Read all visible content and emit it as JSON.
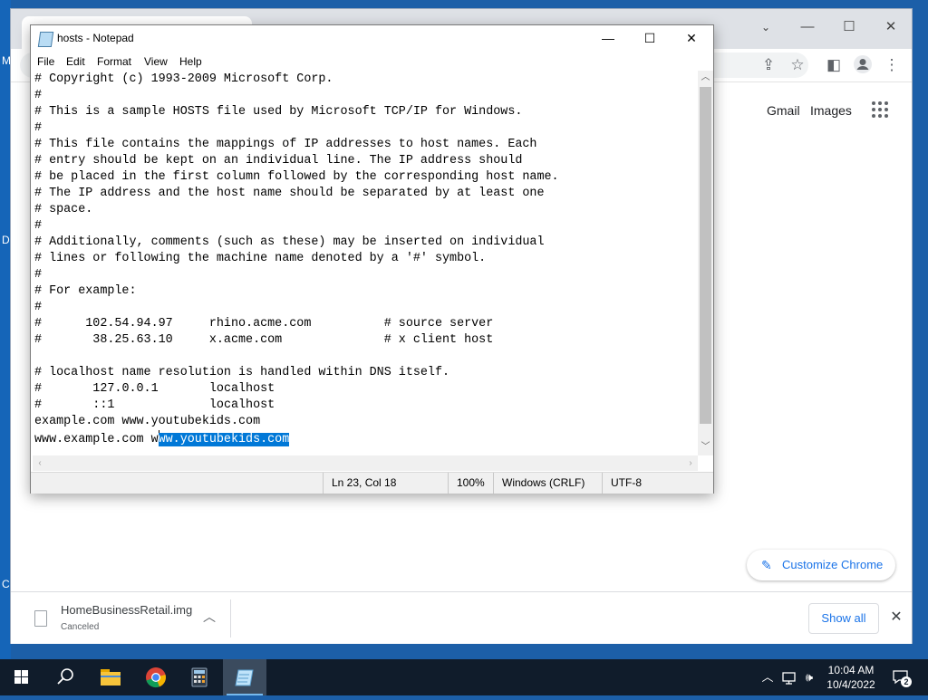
{
  "desktop": {
    "side_letters": [
      "M",
      "D",
      "C"
    ]
  },
  "chrome": {
    "header_links": {
      "gmail": "Gmail",
      "images": "Images"
    },
    "customize_label": "Customize Chrome",
    "download": {
      "filename": "HomeBusinessRetail.img",
      "status": "Canceled"
    },
    "show_all_label": "Show all",
    "icons": [
      "share-icon",
      "bookmark-star-icon",
      "side-panel-icon",
      "profile-icon",
      "kebab-menu-icon",
      "apps-grid-icon"
    ]
  },
  "notepad": {
    "title": "hosts - Notepad",
    "menu": [
      "File",
      "Edit",
      "Format",
      "View",
      "Help"
    ],
    "lines": [
      "# Copyright (c) 1993-2009 Microsoft Corp.",
      "#",
      "# This is a sample HOSTS file used by Microsoft TCP/IP for Windows.",
      "#",
      "# This file contains the mappings of IP addresses to host names. Each",
      "# entry should be kept on an individual line. The IP address should",
      "# be placed in the first column followed by the corresponding host name.",
      "# The IP address and the host name should be separated by at least one",
      "# space.",
      "#",
      "# Additionally, comments (such as these) may be inserted on individual",
      "# lines or following the machine name denoted by a '#' symbol.",
      "#",
      "# For example:",
      "#",
      "#      102.54.94.97     rhino.acme.com          # source server",
      "#       38.25.63.10     x.acme.com              # x client host",
      "",
      "# localhost name resolution is handled within DNS itself.",
      "#\t127.0.0.1       localhost",
      "#\t::1             localhost",
      "example.com www.youtubekids.com"
    ],
    "last_line": {
      "before": "www.example.com w",
      "selected": "ww.youtubekids.com"
    },
    "status": {
      "position": "Ln 23, Col 18",
      "zoom": "100%",
      "line_ending": "Windows (CRLF)",
      "encoding": "UTF-8"
    }
  },
  "taskbar": {
    "apps": [
      "windows-start",
      "search",
      "file-explorer",
      "google-chrome",
      "calculator",
      "notepad"
    ],
    "active_app": "notepad",
    "clock_time": "10:04 AM",
    "clock_date": "10/4/2022",
    "notification_count": "2"
  }
}
